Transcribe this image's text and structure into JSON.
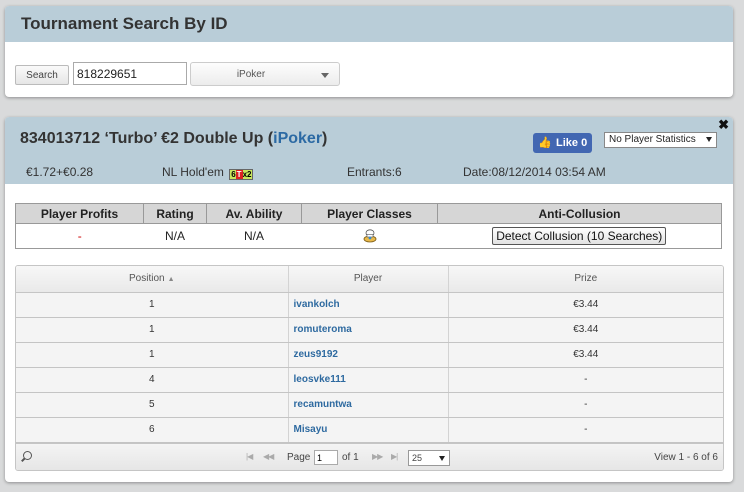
{
  "search_panel": {
    "title": "Tournament Search By ID",
    "search_button": "Search",
    "search_value": "818229651",
    "network_selected": "iPoker"
  },
  "tournament": {
    "title_prefix": "834013712 ‘Turbo’ €2 Double Up (",
    "network_link": "iPoker",
    "title_suffix": ")",
    "close": "✖",
    "like_label": "Like 0",
    "stats_option": "No Player Statistics",
    "buyin": "€1.72+€0.28",
    "game": "NL Hold'em",
    "game_badge": {
      "part1": "6",
      "part2": "T",
      "part3": "x2"
    },
    "entrants": "Entrants:6",
    "date": "Date:08/12/2014 03:54 AM"
  },
  "stats_table": {
    "headers": [
      "Player Profits",
      "Rating",
      "Av. Ability",
      "Player Classes",
      "Anti-Collusion"
    ],
    "profit": "-",
    "rating": "N/A",
    "ability": "N/A",
    "collusion_button": "Detect Collusion (10 Searches)"
  },
  "results": {
    "headers": {
      "position": "Position",
      "player": "Player",
      "prize": "Prize"
    },
    "rows": [
      {
        "position": "1",
        "player": "ivankolch",
        "prize": "€3.44"
      },
      {
        "position": "1",
        "player": "romuteroma",
        "prize": "€3.44"
      },
      {
        "position": "1",
        "player": "zeus9192",
        "prize": "€3.44"
      },
      {
        "position": "4",
        "player": "leosvke111",
        "prize": "-"
      },
      {
        "position": "5",
        "player": "recamuntwa",
        "prize": "-"
      },
      {
        "position": "6",
        "player": "Misayu",
        "prize": "-"
      }
    ],
    "pager": {
      "page_label": "Page",
      "page_value": "1",
      "of_label": "of 1",
      "rows_per_page": "25",
      "view_text": "View 1 - 6 of 6"
    }
  },
  "colors": {
    "header_bg": "#b9cdd8",
    "link": "#2c6aa4",
    "facebook": "#4267b2"
  },
  "icons": [
    "search-icon",
    "close-icon",
    "thumbs-up-icon",
    "chef-icon",
    "sort-icon",
    "first-page-icon",
    "prev-page-icon",
    "next-page-icon",
    "last-page-icon"
  ]
}
